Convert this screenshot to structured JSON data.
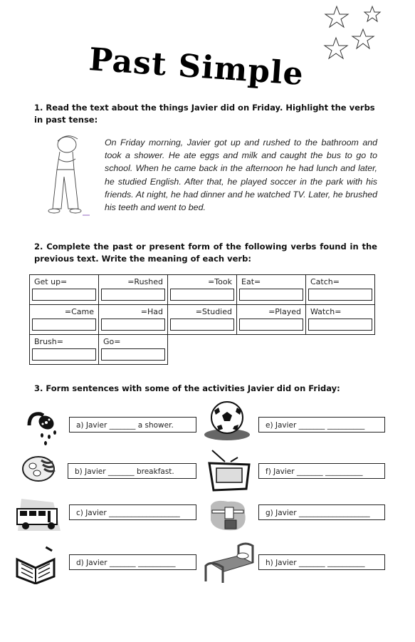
{
  "title": "Past Simple",
  "exercise1": {
    "instruction": "1.  Read the text about the things Javier did on Friday. Highlight the verbs in past tense:",
    "story": "On Friday morning, Javier got up and rushed to the bathroom and took a shower. He ate eggs and milk and caught the bus to go to school. When he came back in the afternoon he had lunch and later, he studied English. After that, he played soccer in the park with his friends. At night, he had dinner and he watched TV. Later, he brushed his teeth and went to bed."
  },
  "exercise2": {
    "instruction": "2. Complete the past or present form of the following verbs found in the previous text. Write the meaning of each verb:",
    "rows": [
      [
        {
          "label": "Get up=",
          "align": "left",
          "answer": ""
        },
        {
          "label": "=Rushed",
          "align": "right",
          "answer": ""
        },
        {
          "label": "=Took",
          "align": "right",
          "answer": ""
        },
        {
          "label": "Eat=",
          "align": "left",
          "answer": ""
        },
        {
          "label": "Catch=",
          "align": "left",
          "answer": ""
        }
      ],
      [
        {
          "label": "=Came",
          "align": "right",
          "answer": ""
        },
        {
          "label": "=Had",
          "align": "right",
          "answer": ""
        },
        {
          "label": "=Studied",
          "align": "right",
          "answer": ""
        },
        {
          "label": "=Played",
          "align": "right",
          "answer": ""
        },
        {
          "label": "Watch=",
          "align": "left",
          "answer": ""
        }
      ],
      [
        {
          "label": "Brush=",
          "align": "left",
          "answer": ""
        },
        {
          "label": "Go=",
          "align": "left",
          "answer": ""
        }
      ]
    ]
  },
  "exercise3": {
    "instruction": "3. Form sentences with some of the activities Javier did on Friday:",
    "sentences": [
      {
        "id": "a",
        "text": "a) Javier _______ a shower.",
        "icon": "shower-icon"
      },
      {
        "id": "b",
        "text": "b) Javier _______ breakfast.",
        "icon": "breakfast-icon"
      },
      {
        "id": "c",
        "text": "c) Javier ___________________",
        "icon": "bus-icon"
      },
      {
        "id": "d",
        "text": "d) Javier _______ __________",
        "icon": "book-icon"
      },
      {
        "id": "e",
        "text": "e) Javier _______ __________",
        "icon": "soccer-ball-icon"
      },
      {
        "id": "f",
        "text": "f) Javier _______ __________",
        "icon": "tv-icon"
      },
      {
        "id": "g",
        "text": "g) Javier ___________________",
        "icon": "toothbrush-icon"
      },
      {
        "id": "h",
        "text": "h) Javier _______ __________",
        "icon": "bed-icon"
      }
    ]
  }
}
